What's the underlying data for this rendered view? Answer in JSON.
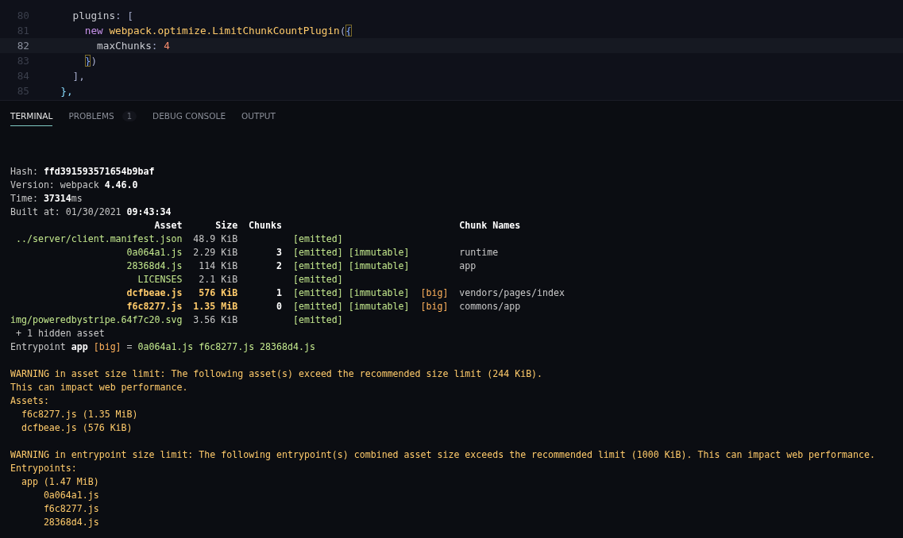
{
  "editor": {
    "lines": [
      {
        "number": "80",
        "current": false,
        "tokens": [
          {
            "text": "    plugins",
            "kind": "property"
          },
          {
            "text": ": [",
            "kind": "punct"
          }
        ]
      },
      {
        "number": "81",
        "current": false,
        "tokens": [
          {
            "text": "      new",
            "kind": "keyword"
          },
          {
            "text": " webpack.optimize.LimitChunkCountPlugin",
            "kind": "class"
          },
          {
            "text": "(",
            "kind": "punct"
          },
          {
            "text": "{",
            "kind": "matched"
          }
        ]
      },
      {
        "number": "82",
        "current": true,
        "tokens": [
          {
            "text": "        maxChunks",
            "kind": "property"
          },
          {
            "text": ": ",
            "kind": "punct"
          },
          {
            "text": "4",
            "kind": "number"
          }
        ]
      },
      {
        "number": "83",
        "current": false,
        "tokens": [
          {
            "text": "      }",
            "kind": "matched"
          },
          {
            "text": ")",
            "kind": "punct"
          }
        ]
      },
      {
        "number": "84",
        "current": false,
        "tokens": [
          {
            "text": "    ],",
            "kind": "punct"
          }
        ]
      },
      {
        "number": "85",
        "current": false,
        "tokens": [
          {
            "text": "  },",
            "kind": "brace"
          }
        ]
      }
    ]
  },
  "panel": {
    "tabs": [
      {
        "label": "TERMINAL",
        "selected": true
      },
      {
        "label": "PROBLEMS",
        "selected": false,
        "badge": "1"
      },
      {
        "label": "DEBUG CONSOLE",
        "selected": false
      },
      {
        "label": "OUTPUT",
        "selected": false
      }
    ]
  },
  "terminal": {
    "summary": [
      {
        "label": "Hash:",
        "value": "ffd391593571654b9baf"
      },
      {
        "label": "Version: webpack",
        "value": "4.46.0"
      },
      {
        "label": "Time:",
        "value": "37314",
        "unit": "ms"
      },
      {
        "label": "Built at: 01/30/2021",
        "value": "09:43:34"
      }
    ],
    "table": {
      "columns": [
        "Asset",
        "Size",
        "Chunks",
        "Chunk Names"
      ],
      "rows": [
        {
          "asset": "../server/client.manifest.json",
          "size": "48.9 KiB",
          "emitted": "[emitted]",
          "oversize": false
        },
        {
          "asset": "0a064a1.js",
          "size": "2.29 KiB",
          "chunks": "3",
          "emitted": "[emitted]",
          "immutable": "[immutable]",
          "chunk_names": "runtime",
          "oversize": false
        },
        {
          "asset": "28368d4.js",
          "size": "114 KiB",
          "chunks": "2",
          "emitted": "[emitted]",
          "immutable": "[immutable]",
          "chunk_names": "app",
          "oversize": false
        },
        {
          "asset": "LICENSES",
          "size": "2.1 KiB",
          "emitted": "[emitted]",
          "oversize": false
        },
        {
          "asset": "dcfbeae.js",
          "size": "576 KiB",
          "chunks": "1",
          "emitted": "[emitted]",
          "immutable": "[immutable]",
          "big": "[big]",
          "chunk_names": "vendors/pages/index",
          "oversize": true
        },
        {
          "asset": "f6c8277.js",
          "size": "1.35 MiB",
          "chunks": "0",
          "emitted": "[emitted]",
          "immutable": "[immutable]",
          "big": "[big]",
          "chunk_names": "commons/app",
          "oversize": true
        },
        {
          "asset": "img/poweredbystripe.64f7c20.svg",
          "size": "3.56 KiB",
          "emitted": "[emitted]",
          "oversize": false
        }
      ]
    },
    "hidden_note": "+ 1 hidden asset",
    "entrypoint": {
      "label": "Entrypoint",
      "name": "app",
      "tag": "[big]",
      "separator": "=",
      "files": "0a064a1.js f6c8277.js 28368d4.js"
    },
    "warnings": [
      {
        "lines": [
          "WARNING in asset size limit: The following asset(s) exceed the recommended size limit (244 KiB).",
          "This can impact web performance."
        ],
        "list": {
          "text": "Assets:",
          "children": [
            {
              "text": "f6c8277.js (1.35 MiB)"
            },
            {
              "text": "dcfbeae.js (576 KiB)"
            }
          ]
        }
      },
      {
        "lines": [
          "WARNING in entrypoint size limit: The following entrypoint(s) combined asset size exceeds the recommended limit (1000 KiB). This can impact web performance."
        ],
        "list": {
          "text": "Entrypoints:",
          "children": [
            {
              "text": "app (1.47 MiB)",
              "children": [
                {
                  "text": "0a064a1.js"
                },
                {
                  "text": "f6c8277.js"
                },
                {
                  "text": "28368d4.js"
                }
              ]
            }
          ]
        }
      }
    ]
  }
}
